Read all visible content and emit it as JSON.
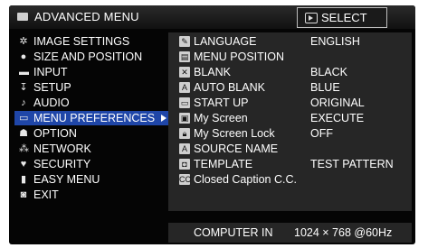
{
  "title": "ADVANCED MENU",
  "select_label": "SELECT",
  "left_menu": [
    {
      "label": "IMAGE SETTINGS",
      "icon": "image-settings-icon"
    },
    {
      "label": "SIZE AND POSITION",
      "icon": "size-position-icon"
    },
    {
      "label": "INPUT",
      "icon": "input-icon"
    },
    {
      "label": "SETUP",
      "icon": "setup-icon"
    },
    {
      "label": "AUDIO",
      "icon": "audio-icon"
    },
    {
      "label": "MENU PREFERENCES",
      "icon": "menu-preferences-icon",
      "active": true
    },
    {
      "label": "OPTION",
      "icon": "option-icon"
    },
    {
      "label": "NETWORK",
      "icon": "network-icon"
    },
    {
      "label": "SECURITY",
      "icon": "security-icon"
    },
    {
      "label": "EASY MENU",
      "icon": "easy-menu-icon"
    },
    {
      "label": "EXIT",
      "icon": "exit-icon"
    }
  ],
  "right_menu": [
    {
      "label": "LANGUAGE",
      "value": "ENGLISH",
      "icon": "language-icon"
    },
    {
      "label": "MENU POSITION",
      "value": "",
      "icon": "menu-position-icon"
    },
    {
      "label": "BLANK",
      "value": "BLACK",
      "icon": "blank-icon"
    },
    {
      "label": "AUTO BLANK",
      "value": "BLUE",
      "icon": "auto-blank-icon"
    },
    {
      "label": "START UP",
      "value": "ORIGINAL",
      "icon": "start-up-icon"
    },
    {
      "label": "My Screen",
      "value": "EXECUTE",
      "icon": "my-screen-icon"
    },
    {
      "label": "My Screen Lock",
      "value": "OFF",
      "icon": "my-screen-lock-icon"
    },
    {
      "label": "SOURCE NAME",
      "value": "",
      "icon": "source-name-icon"
    },
    {
      "label": "TEMPLATE",
      "value": "TEST PATTERN",
      "icon": "template-icon"
    },
    {
      "label": "Closed Caption C.C.",
      "value": "",
      "icon": "closed-caption-icon"
    }
  ],
  "status": {
    "source": "COMPUTER IN",
    "signal": "1024 × 768 @60Hz"
  },
  "colors": {
    "background": "#050505",
    "panel": "#262626",
    "highlight": "#1f46a8",
    "text": "#ffffff"
  }
}
